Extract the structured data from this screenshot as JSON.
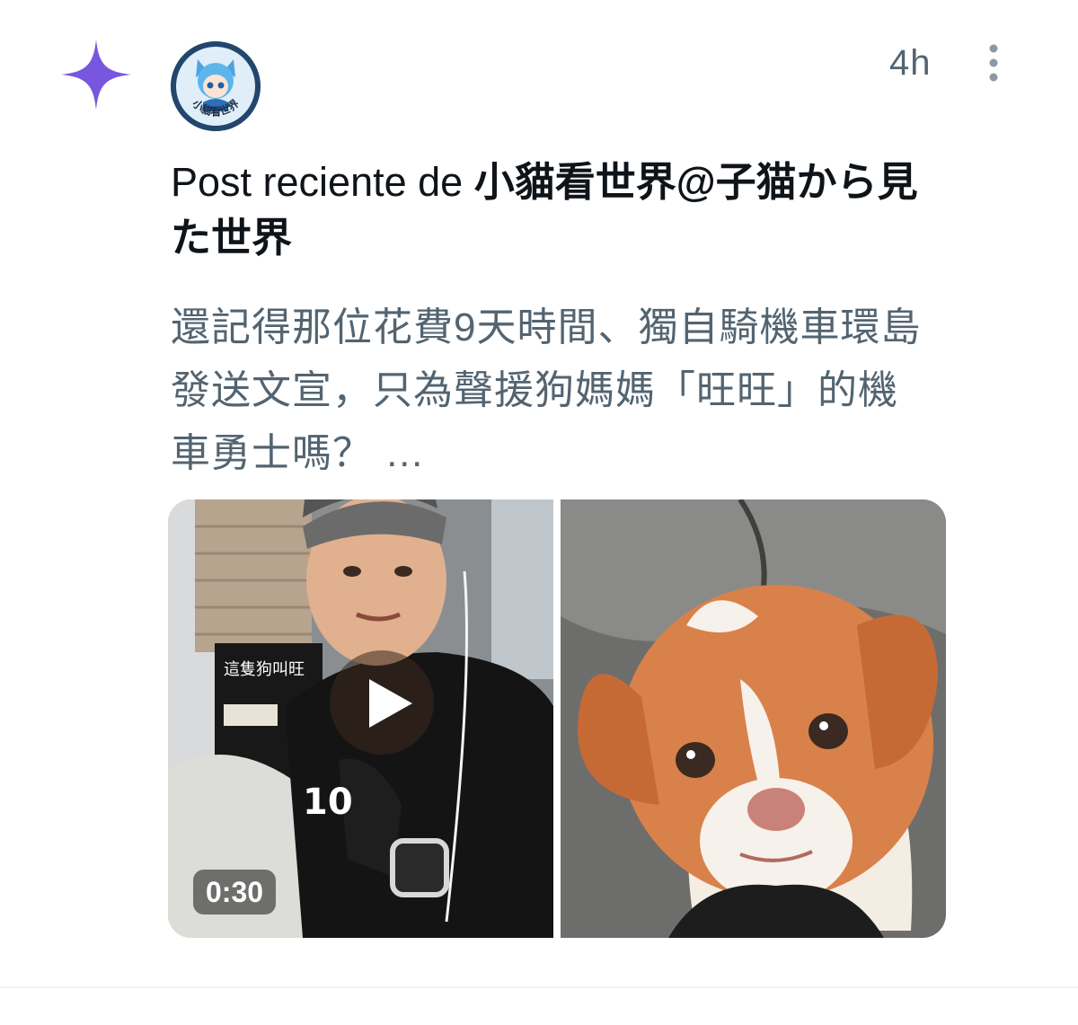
{
  "post": {
    "timestamp": "4h",
    "title_prefix": "Post reciente de ",
    "author_name": "小貓看世界@子猫から見た世界",
    "body": "還記得那位花費9天時間、獨自騎機車環島發送文宣，只為聲援狗媽媽「旺旺」的機車勇士嗎？ …",
    "avatar_text": "小貓看世界",
    "video_duration": "0:30",
    "sign_text": "這隻狗叫旺"
  },
  "icons": {
    "recommendation": "sparkle-icon",
    "menu": "more-vertical-icon",
    "play": "play-icon"
  },
  "colors": {
    "sparkle": "#7856e0",
    "secondary_text": "#536471",
    "primary_text": "#0f1419"
  }
}
